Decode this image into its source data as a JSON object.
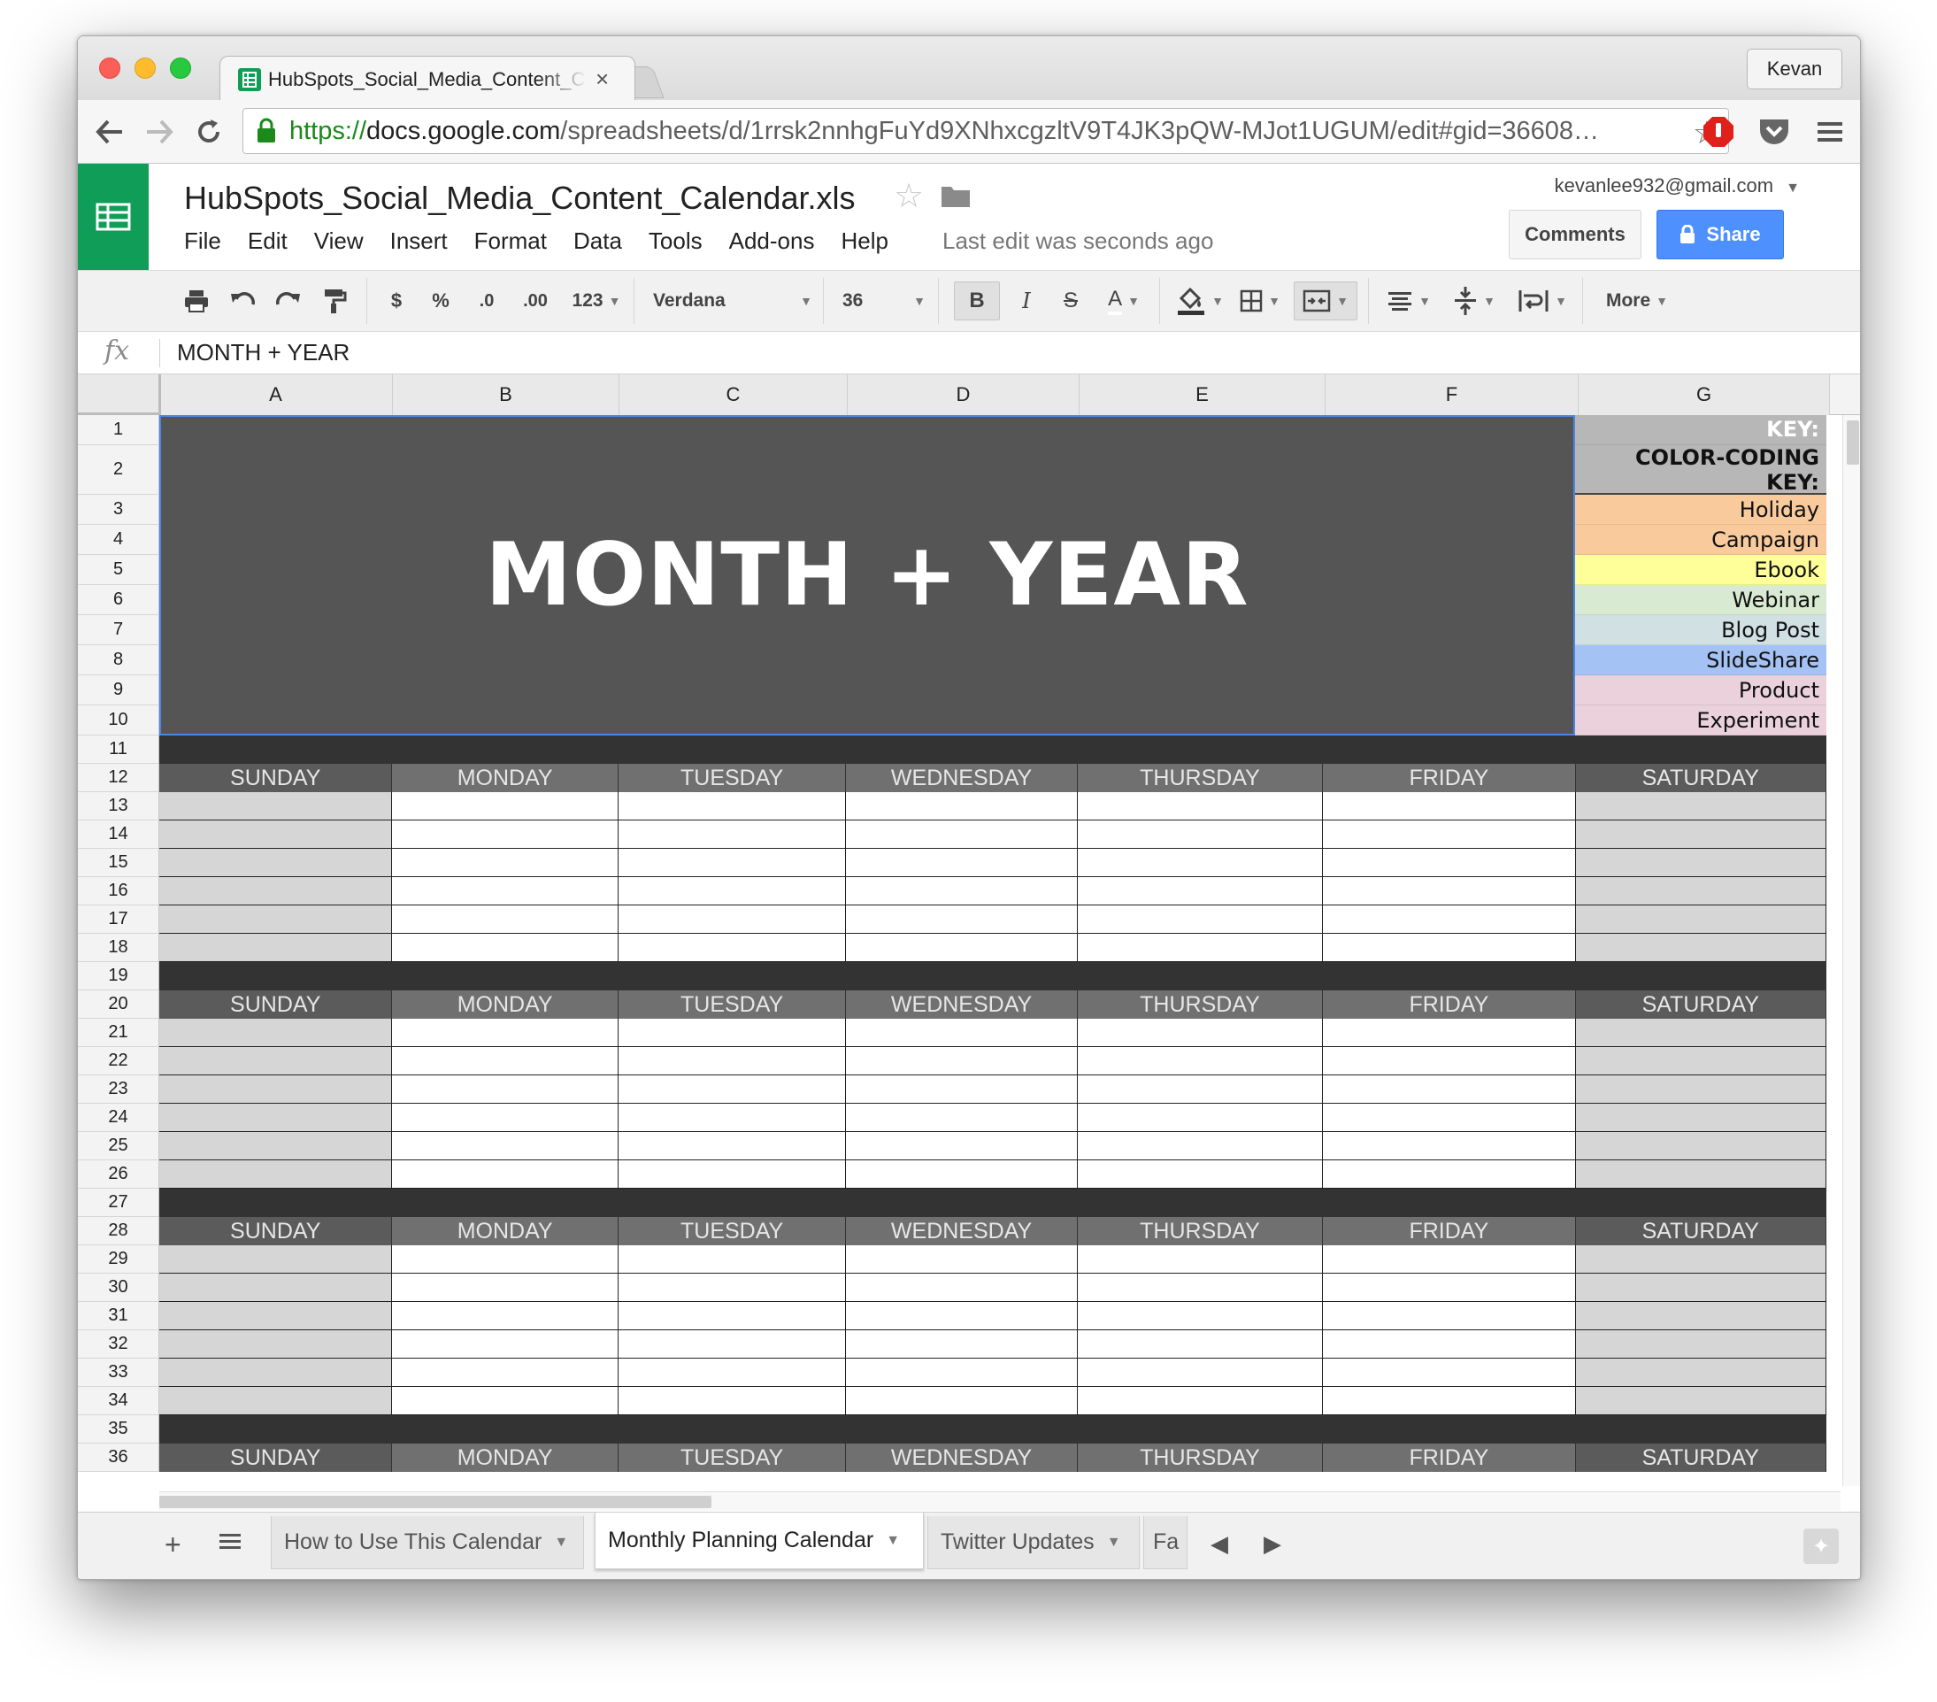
{
  "browser": {
    "tab_title": "HubSpots_Social_Media_Content_Calendar.xls",
    "tab_close": "×",
    "profile_name": "Kevan",
    "url_scheme": "https://",
    "url_domain": "docs.google.com",
    "url_path": "/spreadsheets/d/1rrsk2nnhgFuYd9XNhxcgzltV9T4JK3pQW-MJot1UGUM/edit#gid=36608…"
  },
  "doc": {
    "title": "HubSpots_Social_Media_Content_Calendar.xls",
    "menu": [
      "File",
      "Edit",
      "View",
      "Insert",
      "Format",
      "Data",
      "Tools",
      "Add-ons",
      "Help"
    ],
    "last_edit": "Last edit was seconds ago",
    "account": "kevanlee932@gmail.com",
    "comments_label": "Comments",
    "share_label": "Share"
  },
  "toolbar": {
    "currency": "$",
    "percent": "%",
    "dec_less": ".0",
    "dec_more": ".00",
    "more_formats": "123",
    "font": "Verdana",
    "font_size": "36",
    "bold": "B",
    "italic": "I",
    "strike": "S",
    "text_color": "A",
    "more": "More"
  },
  "formula": {
    "fx": "fx",
    "value": "MONTH + YEAR"
  },
  "grid": {
    "columns": [
      "A",
      "B",
      "C",
      "D",
      "E",
      "F",
      "G"
    ],
    "rows": [
      "1",
      "2",
      "3",
      "4",
      "5",
      "6",
      "7",
      "8",
      "9",
      "10",
      "11",
      "12",
      "13",
      "14",
      "15",
      "16",
      "17",
      "18",
      "19",
      "20",
      "21",
      "22",
      "23",
      "24",
      "25",
      "26",
      "27",
      "28",
      "29",
      "30",
      "31",
      "32",
      "33",
      "34",
      "35",
      "36"
    ],
    "title": "MONTH + YEAR",
    "key_label": "KEY:",
    "color_key_label": "COLOR-CODING KEY:",
    "key_items": [
      {
        "label": "Holiday",
        "color": "#f9cb9c"
      },
      {
        "label": "Campaign",
        "color": "#f9cb9c"
      },
      {
        "label": "Ebook",
        "color": "#ffff99"
      },
      {
        "label": "Webinar",
        "color": "#d9ead3"
      },
      {
        "label": "Blog Post",
        "color": "#d0e0e3"
      },
      {
        "label": "SlideShare",
        "color": "#a4c2f4"
      },
      {
        "label": "Product",
        "color": "#ead1dc"
      },
      {
        "label": "Experiment",
        "color": "#ead1dc"
      }
    ],
    "days": [
      "SUNDAY",
      "MONDAY",
      "TUESDAY",
      "WEDNESDAY",
      "THURSDAY",
      "FRIDAY",
      "SATURDAY"
    ]
  },
  "sheets": {
    "tabs": [
      "How to Use This Calendar",
      "Monthly Planning Calendar",
      "Twitter Updates",
      "Fa"
    ],
    "active": "Monthly Planning Calendar"
  },
  "colors": {
    "sheets_green": "#0f9d58",
    "share_blue": "#4d90fe",
    "title_block": "#555555",
    "selection": "#4a86e8"
  }
}
